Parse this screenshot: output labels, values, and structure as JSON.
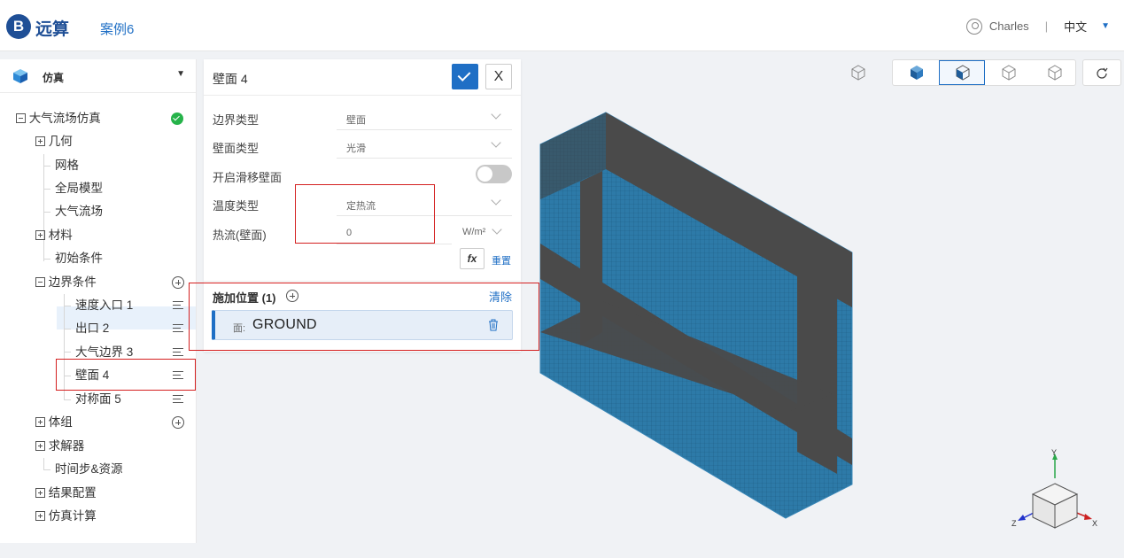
{
  "header": {
    "logo_letter": "B",
    "brand": "远算",
    "case_name": "案例6",
    "user_name": "Charles",
    "separator": "|",
    "language": "中文"
  },
  "sidebar": {
    "title": "仿真",
    "tree": [
      {
        "label": "大气流场仿真",
        "status": "ok"
      },
      {
        "label": "几何"
      },
      {
        "label": "网格"
      },
      {
        "label": "全局模型"
      },
      {
        "label": "大气流场"
      },
      {
        "label": "材料"
      },
      {
        "label": "初始条件"
      },
      {
        "label": "边界条件"
      },
      {
        "label": "速度入口 1"
      },
      {
        "label": "出口 2"
      },
      {
        "label": "大气边界 3"
      },
      {
        "label": "壁面 4",
        "selected": true
      },
      {
        "label": "对称面 5"
      },
      {
        "label": "体组"
      },
      {
        "label": "求解器"
      },
      {
        "label": "时间步&资源"
      },
      {
        "label": "结果配置"
      },
      {
        "label": "仿真计算"
      }
    ]
  },
  "panel": {
    "title": "壁面 4",
    "close_label": "X",
    "fields": [
      {
        "label": "边界类型",
        "value": "壁面"
      },
      {
        "label": "壁面类型",
        "value": "光滑"
      },
      {
        "label": "开启滑移壁面",
        "value": "off"
      },
      {
        "label": "温度类型",
        "value": "定热流"
      },
      {
        "label": "热流(壁面)",
        "value": "0",
        "unit": "W/m²"
      }
    ],
    "fx_label": "fx",
    "reset_label": "重置",
    "location_title": "施加位置 (1)",
    "clear_label": "清除",
    "location_item": {
      "prefix": "面:",
      "name": "GROUND"
    }
  },
  "viewport": {
    "axes": {
      "x": "X",
      "y": "Y",
      "z": "Z"
    },
    "colors": {
      "mesh_blue": "#2d7aa8",
      "band_gray": "#4a4a4a",
      "accent": "#1f6fc5",
      "highlight_red": "#d42020"
    }
  }
}
